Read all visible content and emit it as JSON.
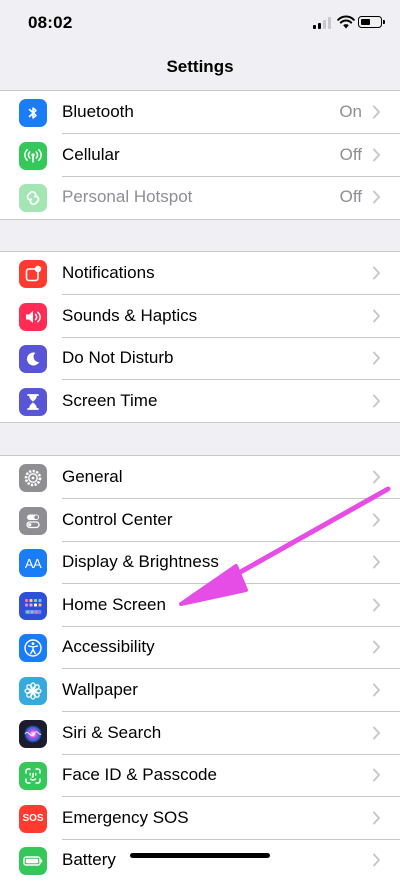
{
  "status_bar": {
    "time": "08:02"
  },
  "nav": {
    "title": "Settings"
  },
  "group1": [
    {
      "label": "Bluetooth",
      "value": "On",
      "icon": "bluetooth-icon",
      "color": "#1a7cf7"
    },
    {
      "label": "Cellular",
      "value": "Off",
      "icon": "cellular-antenna-icon",
      "color": "#34c759"
    },
    {
      "label": "Personal Hotspot",
      "value": "Off",
      "icon": "hotspot-link-icon",
      "color": "#34c759",
      "disabled": true
    }
  ],
  "group2": [
    {
      "label": "Notifications",
      "icon": "notifications-icon",
      "color": "#ff3b30"
    },
    {
      "label": "Sounds & Haptics",
      "icon": "speaker-icon",
      "color": "#ff2d55"
    },
    {
      "label": "Do Not Disturb",
      "icon": "moon-icon",
      "color": "#5856d6"
    },
    {
      "label": "Screen Time",
      "icon": "hourglass-icon",
      "color": "#5856d6"
    }
  ],
  "group3": [
    {
      "label": "General",
      "icon": "gear-icon",
      "color": "#8e8e93"
    },
    {
      "label": "Control Center",
      "icon": "toggles-icon",
      "color": "#8e8e93"
    },
    {
      "label": "Display & Brightness",
      "icon": "text-size-icon",
      "color": "#1a7cf7",
      "icon_text": "AA"
    },
    {
      "label": "Home Screen",
      "icon": "home-screen-grid-icon",
      "color": "#2f4fd9"
    },
    {
      "label": "Accessibility",
      "icon": "accessibility-icon",
      "color": "#1a7cf7"
    },
    {
      "label": "Wallpaper",
      "icon": "flower-icon",
      "color": "#36aadc"
    },
    {
      "label": "Siri & Search",
      "icon": "siri-icon",
      "color": "#1c1c2e"
    },
    {
      "label": "Face ID & Passcode",
      "icon": "face-id-icon",
      "color": "#34c759"
    },
    {
      "label": "Emergency SOS",
      "icon": "sos-icon",
      "color": "#ff3b30",
      "icon_text": "SOS"
    },
    {
      "label": "Battery",
      "icon": "battery-icon",
      "color": "#34c759"
    }
  ],
  "annotation": {
    "arrow_color": "#e64ce6",
    "points_to": "Home Screen"
  }
}
